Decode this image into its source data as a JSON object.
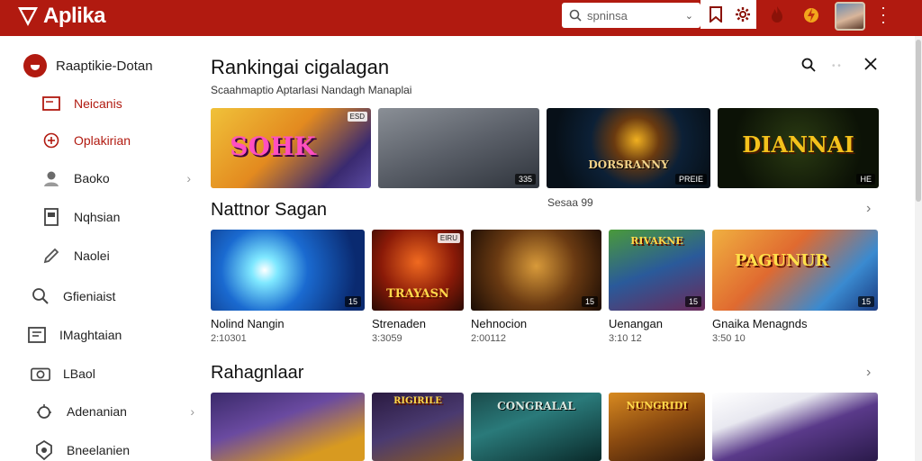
{
  "header": {
    "app_name": "Aplika",
    "search_placeholder": "spninsa",
    "chevron": "⌄",
    "icons": [
      "bookmark-icon",
      "gear-icon",
      "fire-icon",
      "bolt-icon"
    ]
  },
  "sidebar": {
    "brand_label": "Raaptikie-Dotan",
    "items": [
      {
        "label": "Neicanis",
        "icon": "window-icon",
        "red": true
      },
      {
        "label": "Oplakirian",
        "icon": "plus-circle-icon",
        "red": true
      },
      {
        "label": "Baoko",
        "icon": "user-icon",
        "arrow": "›"
      },
      {
        "label": "Nqhsian",
        "icon": "book-icon"
      },
      {
        "label": "Naolei",
        "icon": "pencil-icon"
      },
      {
        "label": "Gfieniaist",
        "icon": "search-icon"
      },
      {
        "label": "IMaghtaian",
        "icon": "news-icon"
      },
      {
        "label": "LBaol",
        "icon": "camera-icon"
      },
      {
        "label": "Adenanian",
        "icon": "bug-icon",
        "arrow": "›"
      },
      {
        "label": "Bneelanien",
        "icon": "badge-icon"
      }
    ]
  },
  "ranking": {
    "title": "Rankingai cigalagan",
    "subtitle": "Scaahmaptio Aptarlasi Nandagh Manaplai",
    "cards": [
      {
        "text": "SOHK",
        "badge": "",
        "top_badge": "ESD"
      },
      {
        "text": "",
        "badge": "335",
        "top_badge": ""
      },
      {
        "text": "DORSRANNY",
        "badge": "PREIE",
        "top_badge": ""
      },
      {
        "text": "DIANNAI",
        "badge": "HE",
        "top_badge": ""
      }
    ]
  },
  "section1": {
    "title": "Nattnor Sagan",
    "meta": "Sesaa 99",
    "arrow": "›",
    "cards": [
      {
        "name": "Nolind Nangin",
        "sub": "2:10301",
        "badge": "15",
        "text": "",
        "top_badge": ""
      },
      {
        "name": "Strenaden",
        "sub": "3:3059",
        "badge": "",
        "text": "TRAYASN",
        "top_badge": "EIRU"
      },
      {
        "name": "Nehnocion",
        "sub": "2:00112",
        "badge": "15",
        "text": "",
        "top_badge": ""
      },
      {
        "name": "Uenangan",
        "sub": "3:10 12",
        "badge": "15",
        "text": "RIVAKNE",
        "top_badge": ""
      },
      {
        "name": "Gnaika Menagnds",
        "sub": "3:50 10",
        "badge": "15",
        "text": "PAGUNUR",
        "top_badge": ""
      }
    ]
  },
  "section2": {
    "title": "Rahagnlaar",
    "arrow": "›",
    "cards": [
      {
        "text": ""
      },
      {
        "text": "RIGIRILE"
      },
      {
        "text": "CONGRALAL"
      },
      {
        "text": "NUNGRIDI"
      },
      {
        "text": ""
      }
    ]
  },
  "colors": {
    "brand": "#b11a10",
    "accent": "#8b1208"
  }
}
